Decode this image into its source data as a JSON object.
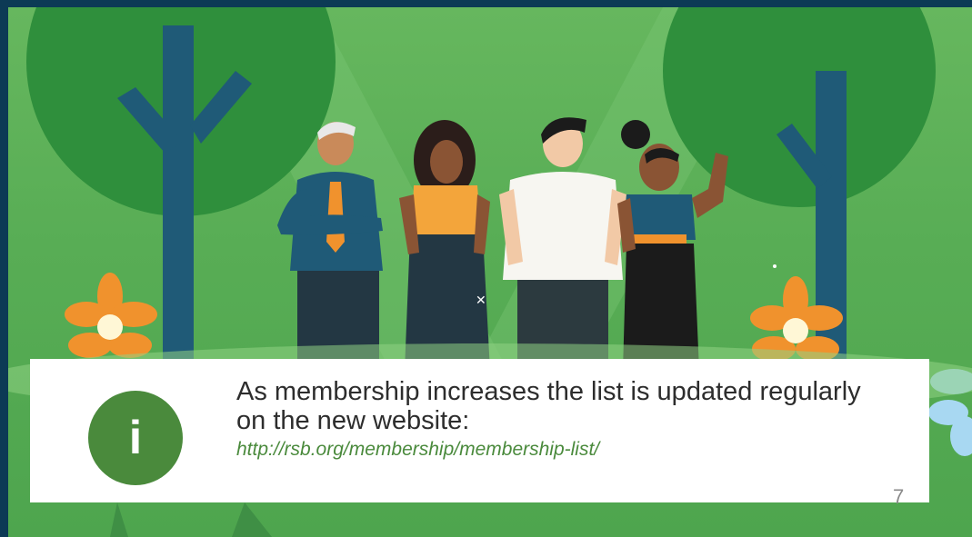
{
  "info": {
    "icon": "info-icon",
    "icon_glyph": "i",
    "message": "As membership increases the list is updated regularly on the new website:",
    "link": "http://rsb.org/membership/membership-list/"
  },
  "page": {
    "number": "7"
  },
  "colors": {
    "accent_green": "#4a8a3c",
    "frame_navy": "#0c3a55",
    "background_green": "#58ad55",
    "panel_white": "#ffffff"
  }
}
